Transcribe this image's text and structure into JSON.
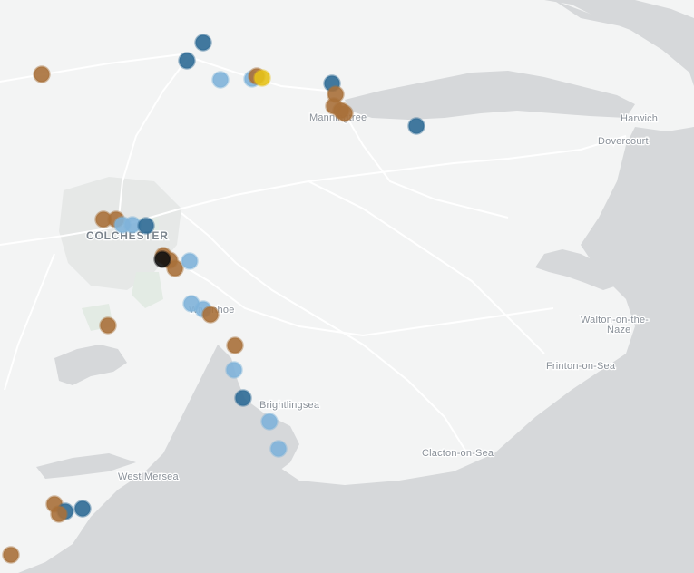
{
  "map": {
    "colors": {
      "sea": "#d6d8da",
      "land": "#f3f4f4",
      "road": "#ffffff",
      "urban": "#e6e8e7",
      "park": "#e3ebe4"
    },
    "labels": {
      "harwich": "Harwich",
      "dovercourt": "Dovercourt",
      "manningtree": "Manningtree",
      "colchester": "COLCHESTER",
      "wivenhoe": "Wivenhoe",
      "walton_line1": "Walton-on-the-",
      "walton_line2": "Naze",
      "frinton": "Frinton-on-Sea",
      "brightlingsea": "Brightlingsea",
      "clacton": "Clacton-on-Sea",
      "west_mersea": "West Mersea"
    },
    "marker_colors": {
      "brown": "#a8703a",
      "light_blue": "#7fb3d9",
      "dark_blue": "#2e6a95",
      "yellow": "#e6c21a",
      "black": "#111111"
    }
  }
}
